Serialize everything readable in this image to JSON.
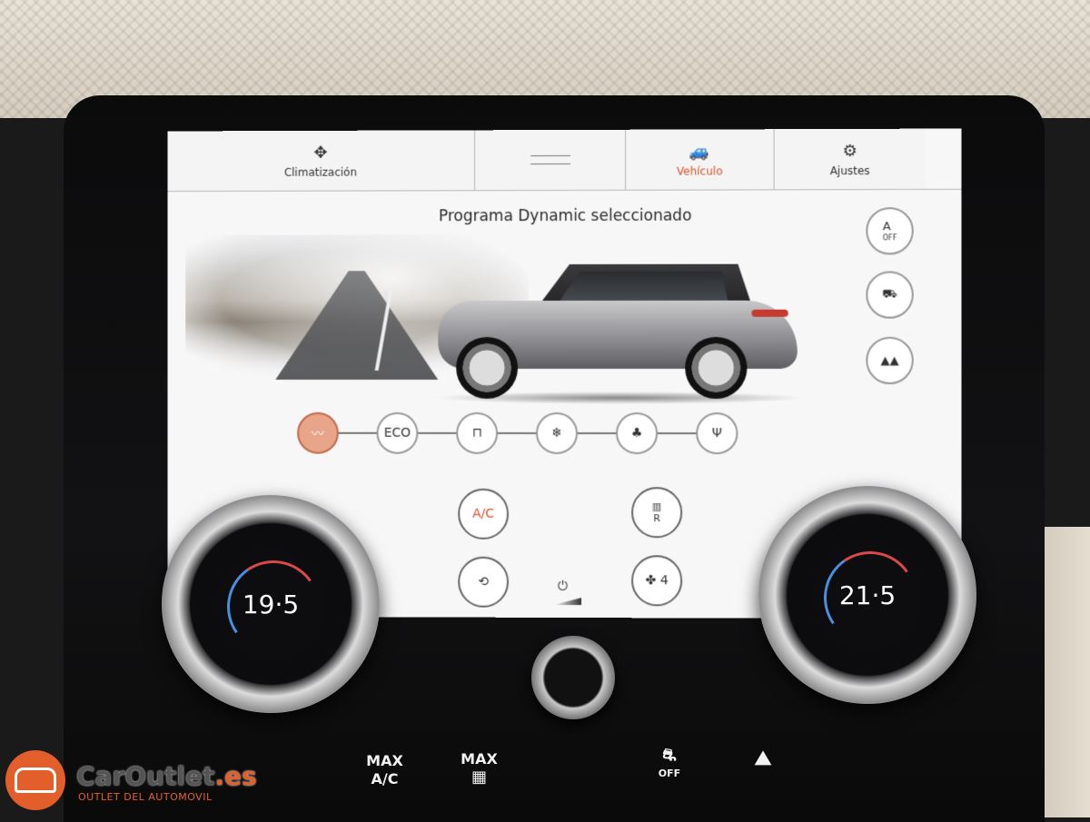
{
  "tabs": [
    {
      "label": "Climatización",
      "icon": "climate-icon"
    },
    {
      "label": "",
      "icon": "drag-handle-icon"
    },
    {
      "label": "Vehículo",
      "icon": "car-icon"
    },
    {
      "label": "Ajustes",
      "icon": "gear-icon"
    }
  ],
  "screen": {
    "title": "Programa Dynamic seleccionado"
  },
  "side_buttons": {
    "auto_off_top": "A",
    "auto_off_bottom": "OFF"
  },
  "modes": [
    {
      "label": "",
      "icon": "dynamic-road-icon",
      "active": true
    },
    {
      "label": "ECO",
      "icon": "eco-icon",
      "active": false
    },
    {
      "label": "",
      "icon": "comfort-icon",
      "active": false
    },
    {
      "label": "",
      "icon": "snow-icon",
      "active": false
    },
    {
      "label": "",
      "icon": "mud-icon",
      "active": false
    },
    {
      "label": "",
      "icon": "sand-icon",
      "active": false
    }
  ],
  "climate": {
    "ac_label": "A/C",
    "rear_defrost_label": "R",
    "fan_speed": "4"
  },
  "dials": {
    "left_temp": "19·5",
    "right_temp": "21·5"
  },
  "physical_buttons": {
    "max_ac_top": "MAX",
    "max_ac_bottom": "A/C",
    "max_defrost_top": "MAX",
    "traction_off": "OFF"
  },
  "watermark": {
    "name": "CarOutlet",
    "tld": ".es",
    "tagline": "OUTLET DEL AUTOMOVIL"
  },
  "colors": {
    "accent": "#d9542b",
    "active_mode": "#e8a58a",
    "cold": "#4a8ee0",
    "hot": "#d84a4a"
  }
}
